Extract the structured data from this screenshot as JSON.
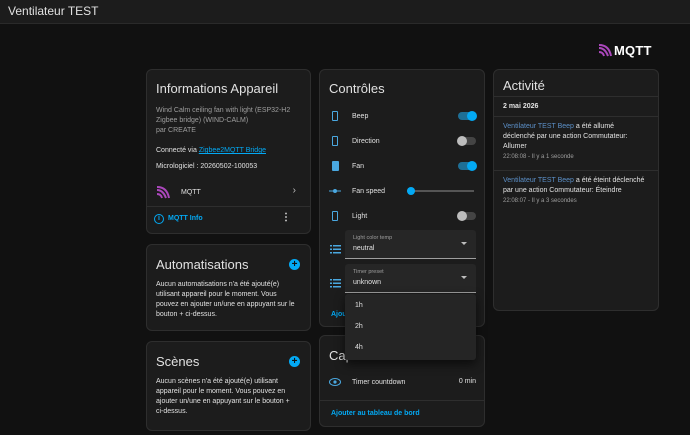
{
  "topbar": {
    "title": "Ventilateur TEST"
  },
  "brand": {
    "logo_text": "MQTT",
    "accent": "#ab47bc"
  },
  "device_info": {
    "title": "Informations Appareil",
    "model_line1": "Wind Calm ceiling fan with light (ESP32-H2",
    "model_line2": "Zigbee bridge) (WIND-CALM)",
    "manufacturer": "par CREATE",
    "connected_prefix": "Connecté via ",
    "connected_link": "Zigbee2MQTT Bridge",
    "firmware": "Micrologiciel : 20260502-100053",
    "integration_label": "MQTT",
    "info_link": "MQTT Info"
  },
  "automations": {
    "title": "Automatisations",
    "text_l1": "Aucun automatisations n'a été ajouté(e)",
    "text_l2": "utilisant appareil pour le moment. Vous",
    "text_l3": "pouvez en ajouter un/une en appuyant sur le",
    "text_l4": "bouton + ci-dessus."
  },
  "scenes": {
    "title": "Scènes",
    "text_l1": "Aucun scènes n'a été ajouté(e) utilisant",
    "text_l2": "appareil pour le moment. Vous pouvez en",
    "text_l3": "ajouter un/une en appuyant sur le bouton +",
    "text_l4": "ci-dessus."
  },
  "controls": {
    "title": "Contrôles",
    "rows": [
      {
        "label": "Beep",
        "state": "on"
      },
      {
        "label": "Direction",
        "state": "off"
      },
      {
        "label": "Fan",
        "state": "on"
      },
      {
        "label": "Fan speed",
        "slider_value": 0
      },
      {
        "label": "Light",
        "state": "off"
      }
    ],
    "light_color_temp": {
      "caption": "Light color temp",
      "value": "neutral"
    },
    "timer_preset": {
      "caption": "Timer preset",
      "value": "unknown"
    },
    "dropdown_options": [
      "1h",
      "2h",
      "4h"
    ],
    "add_link_partial": "Ajou"
  },
  "sensors": {
    "title_partial": "Cap",
    "timer_label": "Timer countdown",
    "timer_value": "0 min",
    "add_link": "Ajouter au tableau de bord"
  },
  "activity": {
    "title": "Activité",
    "date": "2 mai 2026",
    "entries": [
      {
        "entity": "Ventilateur TEST Beep",
        "text_a": " a été allumé",
        "text_b": "déclenché par une action Commutateur:",
        "text_c": "Allumer",
        "time": "22:08:08 - Il y a 1 seconde"
      },
      {
        "entity": "Ventilateur TEST Beep",
        "text_a": " a été éteint déclenché",
        "text_b": "par une action Commutateur: Éteindre",
        "time": "22:08:07 - Il y a 3 secondes"
      }
    ]
  }
}
